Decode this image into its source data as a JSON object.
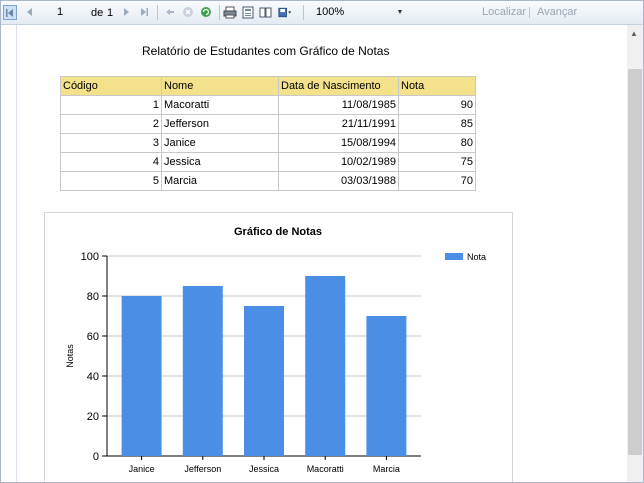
{
  "toolbar": {
    "page_current": "1",
    "page_of": "de",
    "page_total": "1",
    "zoom": "100%",
    "find_label": "Localizar",
    "next_label": "Avançar"
  },
  "report": {
    "title": "Relatório de Estudantes com Gráfico de Notas",
    "columns": [
      "Código",
      "Nome",
      "Data de Nascimento",
      "Nota"
    ],
    "rows": [
      [
        "1",
        "Macoratti",
        "11/08/1985",
        "90"
      ],
      [
        "2",
        "Jefferson",
        "21/11/1991",
        "85"
      ],
      [
        "3",
        "Janice",
        "15/08/1994",
        "80"
      ],
      [
        "4",
        "Jessica",
        "10/02/1989",
        "75"
      ],
      [
        "5",
        "Marcia",
        "03/03/1988",
        "70"
      ]
    ]
  },
  "chart_data": {
    "type": "bar",
    "title": "Gráfico de Notas",
    "categories": [
      "Janice",
      "Jefferson",
      "Jessica",
      "Macoratti",
      "Marcia"
    ],
    "series": [
      {
        "name": "Nota",
        "values": [
          80,
          85,
          75,
          90,
          70
        ]
      }
    ],
    "xlabel": "",
    "ylabel": "Notas",
    "ylim": [
      0,
      100
    ],
    "yticks": [
      0,
      20,
      40,
      60,
      80,
      100
    ],
    "grid": true,
    "legend": "top-right",
    "color": "#4a8ee6"
  }
}
